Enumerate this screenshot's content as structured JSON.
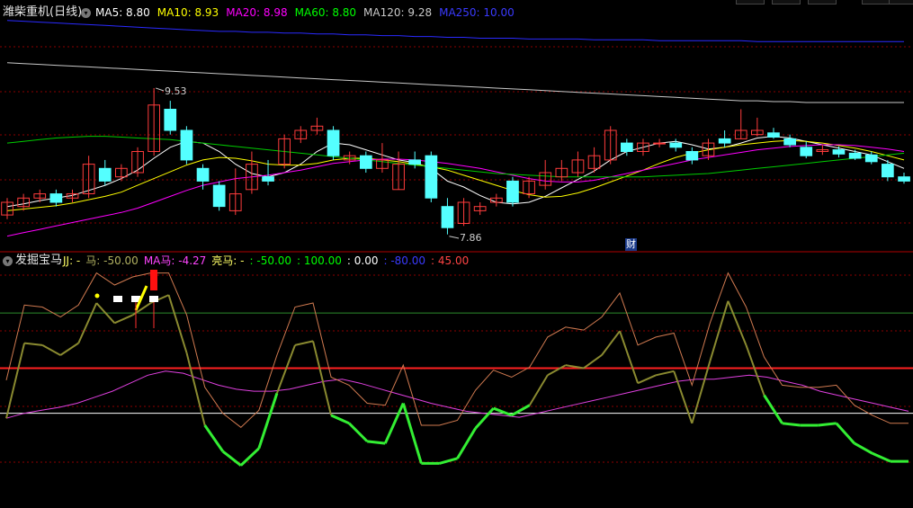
{
  "colors": {
    "background": "#000000",
    "up_candle": "#ff3c3c",
    "down_candle": "#54ffff",
    "ma5": "#ffffff",
    "ma10": "#ffff00",
    "ma20": "#ff00ff",
    "ma60": "#00cc00",
    "ma120": "#c8c8c8",
    "ma250": "#2a2aff",
    "grid": "#8b0000",
    "divider": "#b00000"
  },
  "main_panel": {
    "title": "潍柴重机(日线)",
    "legend": [
      {
        "text": "MA5: 8.80",
        "color": "#ffffff"
      },
      {
        "text": "MA10: 8.93",
        "color": "#ffff00"
      },
      {
        "text": "MA20: 8.98",
        "color": "#ff00ff"
      },
      {
        "text": "MA60: 8.80",
        "color": "#00ff00"
      },
      {
        "text": "MA120: 9.28",
        "color": "#c8c8c8"
      },
      {
        "text": "MA250: 10.00",
        "color": "#3a3aff"
      }
    ],
    "high_label": "9.53",
    "low_label": "7.86",
    "event_label": "财"
  },
  "indicator_panel": {
    "title": "发掘宝马",
    "legend": [
      {
        "text": "JJ: -",
        "color": "#ffff66"
      },
      {
        "text": "马: -50.00",
        "color": "#b0b060"
      },
      {
        "text": "MA马: -4.27",
        "color": "#ff44ff"
      },
      {
        "text": "亮马: -",
        "color": "#ffff66"
      },
      {
        "text": ": -50.00",
        "color": "#00ff00"
      },
      {
        "text": ": 100.00",
        "color": "#00ff00"
      },
      {
        "text": ": 0.00",
        "color": "#ffffff"
      },
      {
        "text": ": -80.00",
        "color": "#3a3aff"
      },
      {
        "text": ": 45.00",
        "color": "#ff4444"
      }
    ]
  },
  "chart_data": {
    "type": "candlestick",
    "price_range": [
      7.6,
      10.3
    ],
    "candles": [
      [
        7.95,
        8.1,
        8.15,
        7.9
      ],
      [
        8.05,
        8.15,
        8.2,
        8.0
      ],
      [
        8.15,
        8.2,
        8.25,
        8.1
      ],
      [
        8.2,
        8.1,
        8.25,
        8.05
      ],
      [
        8.15,
        8.2,
        8.25,
        8.1
      ],
      [
        8.2,
        8.55,
        8.65,
        8.15
      ],
      [
        8.5,
        8.35,
        8.6,
        8.3
      ],
      [
        8.4,
        8.5,
        8.55,
        8.35
      ],
      [
        8.45,
        8.7,
        8.75,
        8.4
      ],
      [
        8.7,
        9.25,
        9.45,
        8.65
      ],
      [
        9.2,
        8.95,
        9.3,
        8.9
      ],
      [
        8.95,
        8.6,
        9.0,
        8.55
      ],
      [
        8.5,
        8.35,
        8.55,
        8.25
      ],
      [
        8.3,
        8.05,
        8.35,
        8.0
      ],
      [
        8.0,
        8.2,
        8.5,
        7.95
      ],
      [
        8.25,
        8.55,
        8.7,
        8.2
      ],
      [
        8.4,
        8.35,
        8.6,
        8.3
      ],
      [
        8.55,
        8.85,
        8.9,
        8.5
      ],
      [
        8.85,
        8.95,
        9.0,
        8.8
      ],
      [
        8.95,
        9.0,
        9.1,
        8.9
      ],
      [
        8.95,
        8.65,
        9.0,
        8.6
      ],
      [
        8.6,
        8.65,
        8.7,
        8.55
      ],
      [
        8.65,
        8.5,
        8.7,
        8.45
      ],
      [
        8.5,
        8.6,
        8.8,
        8.45
      ],
      [
        8.25,
        8.55,
        8.7,
        8.25
      ],
      [
        8.6,
        8.55,
        8.7,
        8.5
      ],
      [
        8.65,
        8.15,
        8.7,
        8.1
      ],
      [
        8.05,
        7.8,
        8.15,
        7.72
      ],
      [
        7.85,
        8.1,
        8.15,
        7.82
      ],
      [
        8.0,
        8.05,
        8.1,
        7.95
      ],
      [
        8.1,
        8.15,
        8.2,
        8.05
      ],
      [
        8.35,
        8.1,
        8.4,
        8.05
      ],
      [
        8.2,
        8.35,
        8.4,
        8.15
      ],
      [
        8.3,
        8.45,
        8.6,
        8.25
      ],
      [
        8.4,
        8.5,
        8.6,
        8.35
      ],
      [
        8.45,
        8.6,
        8.7,
        8.4
      ],
      [
        8.5,
        8.65,
        8.75,
        8.45
      ],
      [
        8.6,
        8.95,
        9.0,
        8.55
      ],
      [
        8.8,
        8.7,
        8.85,
        8.65
      ],
      [
        8.7,
        8.8,
        8.85,
        8.65
      ],
      [
        8.8,
        8.8,
        8.85,
        8.75
      ],
      [
        8.8,
        8.75,
        8.85,
        8.7
      ],
      [
        8.7,
        8.6,
        8.75,
        8.55
      ],
      [
        8.65,
        8.8,
        8.85,
        8.6
      ],
      [
        8.85,
        8.8,
        8.95,
        8.75
      ],
      [
        8.85,
        8.95,
        9.2,
        8.85
      ],
      [
        8.9,
        8.95,
        9.1,
        8.88
      ],
      [
        8.92,
        8.87,
        8.98,
        8.85
      ],
      [
        8.85,
        8.78,
        8.9,
        8.75
      ],
      [
        8.75,
        8.65,
        8.82,
        8.62
      ],
      [
        8.7,
        8.72,
        8.78,
        8.66
      ],
      [
        8.72,
        8.67,
        8.76,
        8.63
      ],
      [
        8.68,
        8.62,
        8.72,
        8.6
      ],
      [
        8.66,
        8.58,
        8.7,
        8.55
      ],
      [
        8.55,
        8.4,
        8.6,
        8.35
      ],
      [
        8.4,
        8.35,
        8.45,
        8.32
      ]
    ],
    "ma_lines": {
      "ma5": [
        8.05,
        8.08,
        8.12,
        8.15,
        8.18,
        8.24,
        8.3,
        8.38,
        8.48,
        8.62,
        8.75,
        8.82,
        8.8,
        8.7,
        8.55,
        8.44,
        8.4,
        8.45,
        8.55,
        8.7,
        8.8,
        8.78,
        8.72,
        8.66,
        8.6,
        8.57,
        8.5,
        8.35,
        8.28,
        8.18,
        8.1,
        8.08,
        8.1,
        8.17,
        8.27,
        8.37,
        8.47,
        8.6,
        8.7,
        8.75,
        8.8,
        8.82,
        8.78,
        8.73,
        8.75,
        8.8,
        8.86,
        8.88,
        8.86,
        8.82,
        8.78,
        8.74,
        8.7,
        8.66,
        8.58,
        8.5
      ],
      "ma10": [
        8.0,
        8.02,
        8.04,
        8.06,
        8.09,
        8.13,
        8.17,
        8.22,
        8.3,
        8.38,
        8.46,
        8.54,
        8.6,
        8.63,
        8.62,
        8.59,
        8.55,
        8.54,
        8.54,
        8.56,
        8.6,
        8.62,
        8.62,
        8.6,
        8.58,
        8.55,
        8.52,
        8.48,
        8.42,
        8.36,
        8.3,
        8.24,
        8.19,
        8.16,
        8.17,
        8.21,
        8.27,
        8.34,
        8.41,
        8.48,
        8.56,
        8.63,
        8.68,
        8.72,
        8.75,
        8.78,
        8.8,
        8.82,
        8.83,
        8.82,
        8.8,
        8.77,
        8.74,
        8.7,
        8.65,
        8.6
      ],
      "ma20": [
        7.7,
        7.74,
        7.78,
        7.82,
        7.86,
        7.9,
        7.94,
        7.98,
        8.03,
        8.1,
        8.17,
        8.24,
        8.3,
        8.34,
        8.38,
        8.4,
        8.42,
        8.45,
        8.48,
        8.52,
        8.56,
        8.58,
        8.6,
        8.61,
        8.61,
        8.6,
        8.58,
        8.56,
        8.53,
        8.5,
        8.46,
        8.42,
        8.38,
        8.35,
        8.34,
        8.34,
        8.36,
        8.4,
        8.44,
        8.48,
        8.52,
        8.56,
        8.6,
        8.63,
        8.66,
        8.69,
        8.72,
        8.74,
        8.76,
        8.77,
        8.78,
        8.78,
        8.77,
        8.75,
        8.73,
        8.7
      ],
      "ma60": [
        8.8,
        8.82,
        8.84,
        8.86,
        8.87,
        8.88,
        8.88,
        8.87,
        8.86,
        8.85,
        8.84,
        8.82,
        8.8,
        8.78,
        8.76,
        8.74,
        8.72,
        8.7,
        8.68,
        8.66,
        8.64,
        8.62,
        8.6,
        8.58,
        8.56,
        8.54,
        8.52,
        8.5,
        8.48,
        8.46,
        8.44,
        8.43,
        8.42,
        8.41,
        8.4,
        8.4,
        8.4,
        8.4,
        8.4,
        8.4,
        8.41,
        8.42,
        8.43,
        8.44,
        8.46,
        8.48,
        8.5,
        8.52,
        8.54,
        8.56,
        8.58,
        8.6,
        8.62,
        8.64,
        8.66,
        8.68
      ],
      "ma120": [
        9.75,
        9.74,
        9.73,
        9.72,
        9.71,
        9.7,
        9.69,
        9.68,
        9.67,
        9.66,
        9.65,
        9.64,
        9.63,
        9.62,
        9.61,
        9.6,
        9.59,
        9.58,
        9.57,
        9.56,
        9.55,
        9.54,
        9.53,
        9.52,
        9.51,
        9.5,
        9.49,
        9.48,
        9.47,
        9.46,
        9.45,
        9.44,
        9.43,
        9.42,
        9.41,
        9.4,
        9.39,
        9.38,
        9.37,
        9.36,
        9.35,
        9.34,
        9.33,
        9.32,
        9.31,
        9.3,
        9.3,
        9.29,
        9.29,
        9.28,
        9.28,
        9.28,
        9.28,
        9.28,
        9.28,
        9.28
      ],
      "ma250": [
        10.25,
        10.24,
        10.23,
        10.22,
        10.21,
        10.2,
        10.19,
        10.18,
        10.17,
        10.16,
        10.15,
        10.14,
        10.13,
        10.12,
        10.12,
        10.11,
        10.11,
        10.1,
        10.1,
        10.09,
        10.09,
        10.08,
        10.08,
        10.07,
        10.07,
        10.06,
        10.06,
        10.05,
        10.05,
        10.04,
        10.04,
        10.04,
        10.03,
        10.03,
        10.03,
        10.03,
        10.02,
        10.02,
        10.02,
        10.02,
        10.01,
        10.01,
        10.01,
        10.01,
        10.01,
        10.01,
        10.0,
        10.0,
        10.0,
        10.0,
        10.0,
        10.0,
        10.0,
        10.0,
        10.0,
        10.0
      ]
    },
    "indicator": {
      "y_range": [
        -90,
        145
      ],
      "levels": [
        {
          "value": 100,
          "color": "#2c8c2c"
        },
        {
          "value": 45,
          "color": "#ff2020",
          "width": 2
        },
        {
          "value": 0,
          "color": "#ffffff"
        }
      ],
      "ma": [
        -5,
        0,
        3,
        6,
        10,
        16,
        22,
        30,
        38,
        42,
        40,
        34,
        28,
        24,
        22,
        22,
        24,
        28,
        32,
        34,
        30,
        25,
        20,
        15,
        10,
        6,
        2,
        0,
        -2,
        -4,
        0,
        4,
        8,
        12,
        16,
        20,
        24,
        28,
        32,
        34,
        34,
        36,
        38,
        36,
        32,
        28,
        22,
        18,
        14,
        10,
        6,
        2
      ],
      "horse": [
        -5,
        70,
        68,
        58,
        70,
        110,
        90,
        98,
        110,
        118,
        60,
        -12,
        -38,
        -52,
        -35,
        20,
        68,
        72,
        -2,
        -10,
        -28,
        -30,
        10,
        -50,
        -50,
        -45,
        -15,
        5,
        -2,
        8,
        38,
        48,
        45,
        58,
        82,
        30,
        38,
        42,
        -10,
        52,
        112,
        68,
        18,
        -10,
        -12,
        -12,
        -10,
        -30,
        -40,
        -48,
        -48
      ]
    }
  }
}
